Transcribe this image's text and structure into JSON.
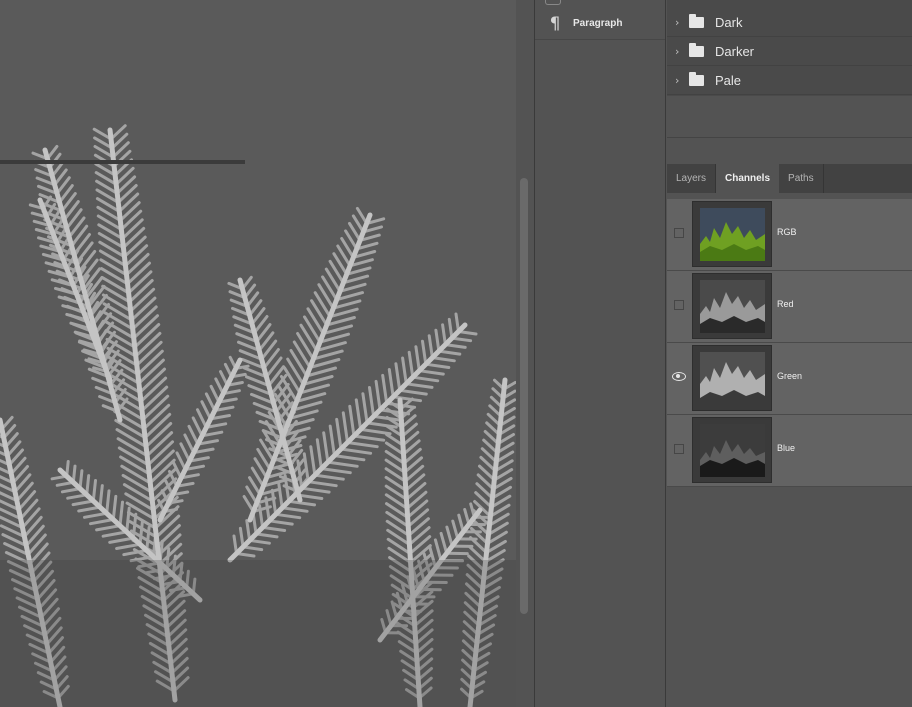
{
  "dock": {
    "paragraph_label": "Paragraph",
    "paragraph_icon": "pilcrow-icon"
  },
  "folders": [
    {
      "name": "Dark"
    },
    {
      "name": "Darker"
    },
    {
      "name": "Pale"
    }
  ],
  "tabs": [
    {
      "label": "Layers",
      "active": false
    },
    {
      "label": "Channels",
      "active": true
    },
    {
      "label": "Paths",
      "active": false
    }
  ],
  "channels": [
    {
      "name": "RGB",
      "visible": false,
      "thumbnail": "color"
    },
    {
      "name": "Red",
      "visible": false,
      "thumbnail": "gray-light"
    },
    {
      "name": "Green",
      "visible": true,
      "thumbnail": "gray-light"
    },
    {
      "name": "Blue",
      "visible": false,
      "thumbnail": "gray-dark"
    }
  ],
  "colors": {
    "canvas_bg": "#5a5a5a",
    "panel_bg": "#535353",
    "tabbar_bg": "#424242",
    "channel_row_bg": "#636363"
  }
}
